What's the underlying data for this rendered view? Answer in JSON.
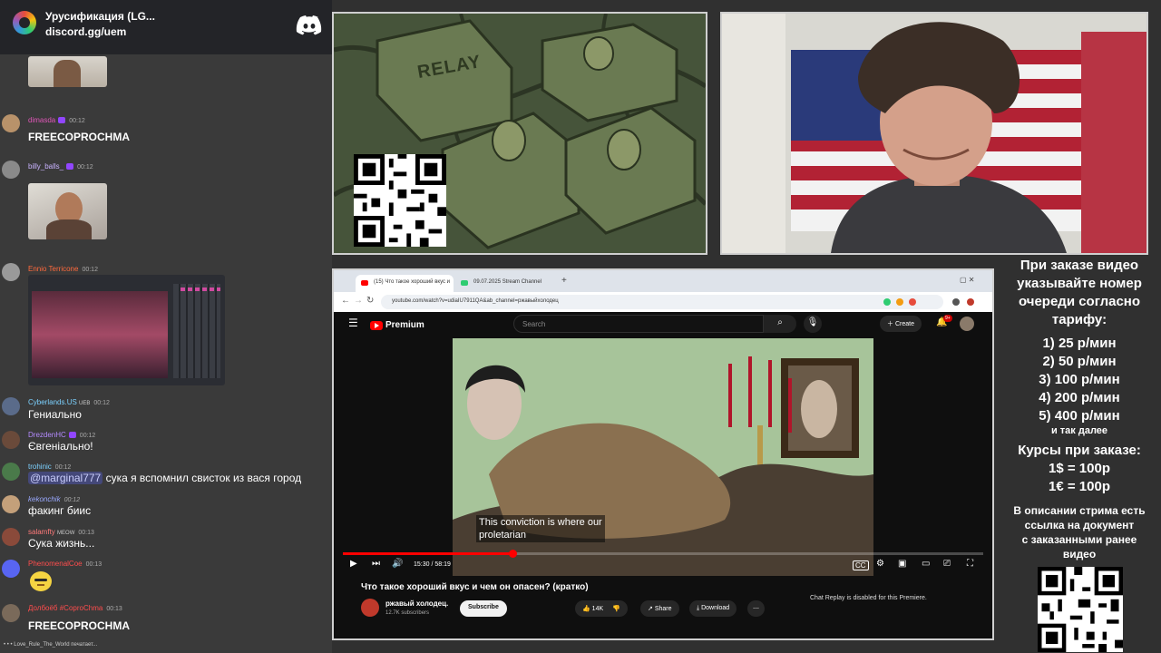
{
  "chat": {
    "server_name": "Урусификация (LG...",
    "server_invite": "discord.gg/uem",
    "messages": [
      {
        "user": "dimasda",
        "time": "00:12",
        "text": "FREECOPROCHMA",
        "color": "#e056b8"
      },
      {
        "user": "billy_balls_",
        "time": "00:12",
        "text": "",
        "color": "#c9b3ff"
      },
      {
        "user": "Ennio Terricone",
        "time": "00:12",
        "text": "",
        "color": "#ff6a3d"
      },
      {
        "user": "Cyberlands.US",
        "time": "00:12",
        "text": "Гениально",
        "badge": "UEB",
        "color": "#7cd1ff"
      },
      {
        "user": "DrezdenHC",
        "time": "00:12",
        "text": "Євгеніально!",
        "color": "#b58bff"
      },
      {
        "user": "trohinic",
        "time": "00:12",
        "mention": "@marginal777",
        "text": "сука я вспомнил свисток из вася город",
        "color": "#7cd1ff"
      },
      {
        "user": "kekonchik",
        "time": "00:12",
        "text": "факинг биис",
        "color": "#9aa9ff"
      },
      {
        "user": "salamfty",
        "time": "00:13",
        "text": "Сука жизнь...",
        "badge": "MEOW",
        "color": "#ff7a7a"
      },
      {
        "user": "PhenomenalCoe",
        "time": "00:13",
        "text": "",
        "color": "#ff4d4d"
      },
      {
        "user": "Долбоёб #CoproChma",
        "time": "00:13",
        "text": "FREECOPROCHMA",
        "color": "#ff4d4d"
      }
    ],
    "typing": "• • • Love_Rule_The_World печатает..."
  },
  "relay_panel": {
    "sign_text": "RELAY"
  },
  "browser": {
    "tabs": [
      {
        "label": "(15) Что такое хороший вкус и",
        "active": true
      },
      {
        "label": "09.07.2025 Stream Channel",
        "active": false
      }
    ],
    "url": "youtube.com/watch?v=udiaIU7911QA&ab_channel=ржавыйхолодец",
    "youtube": {
      "brand": "Premium",
      "search_placeholder": "Search",
      "create_label": "Create",
      "notification_count": "9+",
      "subtitle_line1": "This conviction is where our",
      "subtitle_line2": "proletarian",
      "time": "15:30 / 58:19",
      "progress": 0.265,
      "video_title": "Что такое хороший вкус и чем он опасен? (кратко)",
      "channel_name": "ржавый холодец.",
      "subscribers": "12.7K subscribers",
      "subscribe_label": "Subscribe",
      "likes": "14K",
      "share_label": "Share",
      "download_label": "Download",
      "chat_replay": "Chat Replay is disabled for this Premiere."
    }
  },
  "info": {
    "title_lines": [
      "При заказе видео",
      "указывайте номер",
      "очереди согласно",
      "тарифу:"
    ],
    "tariffs": [
      "1) 25 р/мин",
      "2) 50 р/мин",
      "3) 100 р/мин",
      "4) 200 р/мин",
      "5) 400 р/мин"
    ],
    "etc": "и так далее",
    "rates_title": "Курсы при заказе:",
    "rates": [
      "1$ = 100р",
      "1€ = 100р"
    ],
    "note_lines": [
      "В описании стрима есть",
      "ссылка на документ",
      "с заказанными ранее",
      "видео"
    ]
  }
}
